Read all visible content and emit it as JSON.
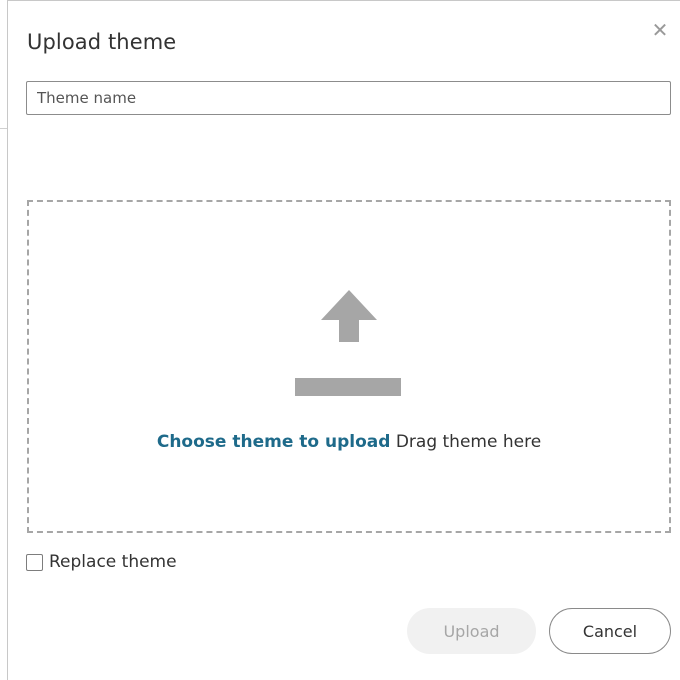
{
  "dialog": {
    "title": "Upload theme",
    "close_icon": "close-icon"
  },
  "name_field": {
    "value": "",
    "placeholder": "Theme name"
  },
  "dropzone": {
    "icon": "upload-arrow-icon",
    "link_text": "Choose theme to upload",
    "hint_text": "Drag theme here"
  },
  "replace_option": {
    "label": "Replace theme",
    "checked": false
  },
  "buttons": {
    "upload_label": "Upload",
    "cancel_label": "Cancel"
  },
  "colors": {
    "link": "#1e6a8a",
    "icon": "#a6a6a6",
    "disabled_button_bg": "#f1f1f1"
  }
}
